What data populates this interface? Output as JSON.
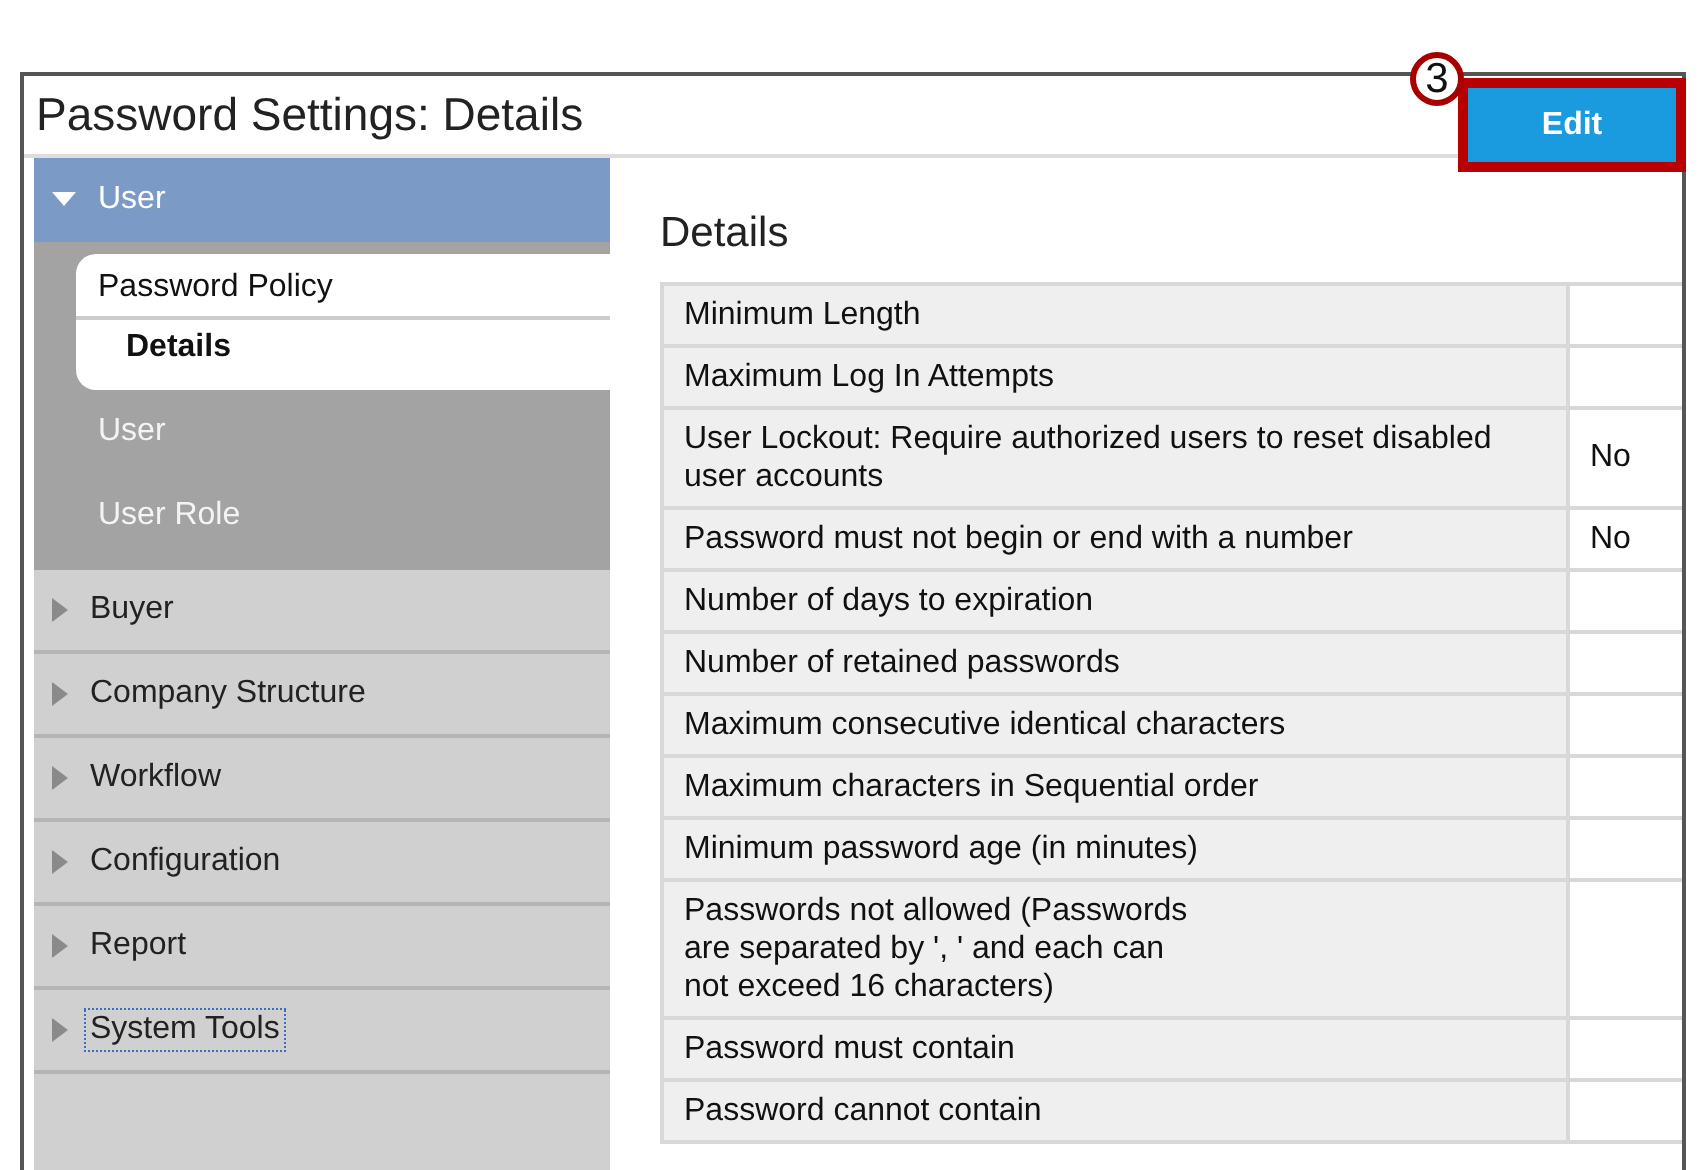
{
  "window": {
    "title": "Password Settings: Details"
  },
  "edit_button": {
    "label": "Edit",
    "step": "3"
  },
  "sidebar": {
    "sections": [
      {
        "label": "User",
        "expanded": true,
        "focused": false,
        "children": [
          {
            "label": "Password Policy",
            "selected": true,
            "children": [
              {
                "label": "Details",
                "selected": true
              }
            ]
          },
          {
            "label": "User",
            "selected": false
          },
          {
            "label": "User Role",
            "selected": false
          }
        ]
      },
      {
        "label": "Buyer",
        "expanded": false,
        "focused": false
      },
      {
        "label": "Company Structure",
        "expanded": false,
        "focused": false
      },
      {
        "label": "Workflow",
        "expanded": false,
        "focused": false
      },
      {
        "label": "Configuration",
        "expanded": false,
        "focused": false
      },
      {
        "label": "Report",
        "expanded": false,
        "focused": false
      },
      {
        "label": "System Tools",
        "expanded": false,
        "focused": true
      }
    ]
  },
  "details": {
    "heading": "Details",
    "rows": [
      {
        "label": "Minimum Length"
      },
      {
        "label": "Maximum Log In Attempts"
      },
      {
        "label": "User Lockout: Require authorized users to reset disabled user accounts",
        "value": "No"
      },
      {
        "label": "Password must not begin or end with a number",
        "value": "No"
      },
      {
        "label": "Number of days to expiration"
      },
      {
        "label": "Number of retained passwords"
      },
      {
        "label": "Maximum consecutive identical characters"
      },
      {
        "label": "Maximum characters in Sequential order"
      },
      {
        "label": "Minimum password age (in minutes)"
      },
      {
        "label": "Passwords not allowed (Passwords\nare separated by ', ' and each can\nnot exceed 16 characters)"
      },
      {
        "label": "Password must contain"
      },
      {
        "label": "Password cannot contain"
      }
    ]
  }
}
